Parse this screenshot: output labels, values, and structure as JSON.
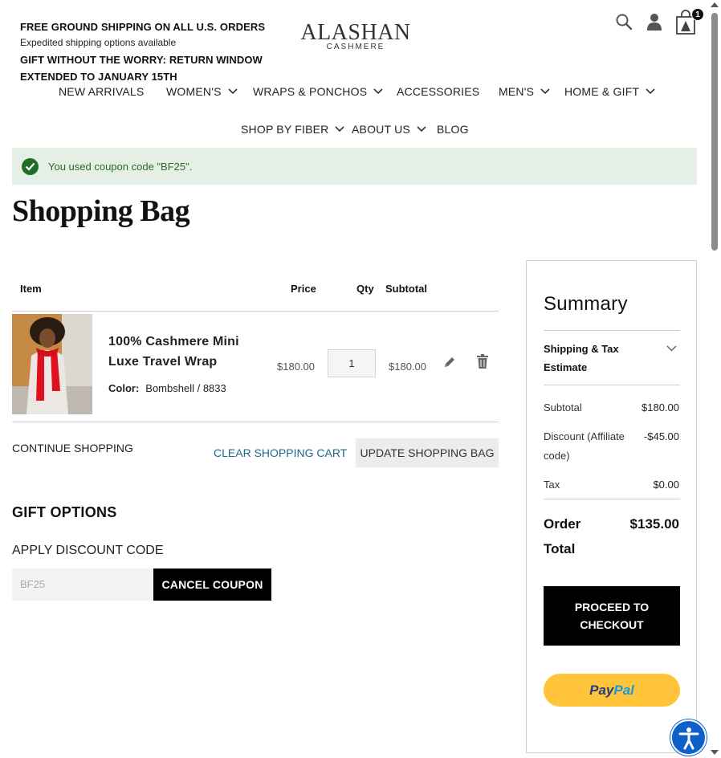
{
  "promo": {
    "line1": "FREE GROUND SHIPPING ON ALL U.S. ORDERS",
    "line2": "Expedited shipping options available",
    "line3": "GIFT WITHOUT THE WORRY: RETURN WINDOW",
    "line4": "EXTENDED TO JANUARY 15TH"
  },
  "logo": {
    "name": "ALASHAN",
    "sub": "CASHMERE"
  },
  "header": {
    "cart_count": "1",
    "icons": [
      "search-icon",
      "account-icon",
      "cart-icon"
    ]
  },
  "nav": {
    "new_arrivals": "NEW ARRIVALS",
    "womens": "WOMEN'S",
    "wraps": "WRAPS & PONCHOS",
    "accessories": "ACCESSORIES",
    "mens": "MEN'S",
    "home_gift": "HOME & GIFT",
    "shop_by_fiber": "SHOP BY FIBER",
    "about_us": "ABOUT US",
    "blog": "BLOG"
  },
  "message": {
    "text": "You used coupon code \"BF25\"."
  },
  "page_title": "Shopping Bag",
  "cart": {
    "headers": {
      "item": "Item",
      "price": "Price",
      "qty": "Qty",
      "subtotal": "Subtotal"
    },
    "items": [
      {
        "name": "100% Cashmere Mini Luxe Travel Wrap",
        "color_label": "Color:",
        "color_value": "Bombshell / 8833",
        "price": "$180.00",
        "qty": "1",
        "subtotal": "$180.00"
      }
    ],
    "continue_label": "CONTINUE SHOPPING",
    "clear_label": "CLEAR SHOPPING CART",
    "update_label": "UPDATE SHOPPING BAG"
  },
  "gift": {
    "title": "GIFT OPTIONS"
  },
  "discount": {
    "label": "APPLY DISCOUNT CODE",
    "value": "BF25",
    "cancel_label": "CANCEL COUPON"
  },
  "summary": {
    "title": "Summary",
    "shipping_label": "Shipping & Tax Estimate",
    "subtotal_label": "Subtotal",
    "subtotal_value": "$180.00",
    "discount_label": "Discount (Affiliate code)",
    "discount_value": "-$45.00",
    "tax_label": "Tax",
    "tax_value": "$0.00",
    "total_label": "Order Total",
    "total_value": "$135.00",
    "checkout_label": "PROCEED TO CHECKOUT",
    "paypal_pay": "Pay",
    "paypal_pal": "Pal"
  },
  "colors": {
    "success_bg": "#e5efe5",
    "success_icon": "#1f6e28",
    "link": "#1a6a8e",
    "paypal": "#ffc439",
    "a11y": "#0e5fc9"
  }
}
